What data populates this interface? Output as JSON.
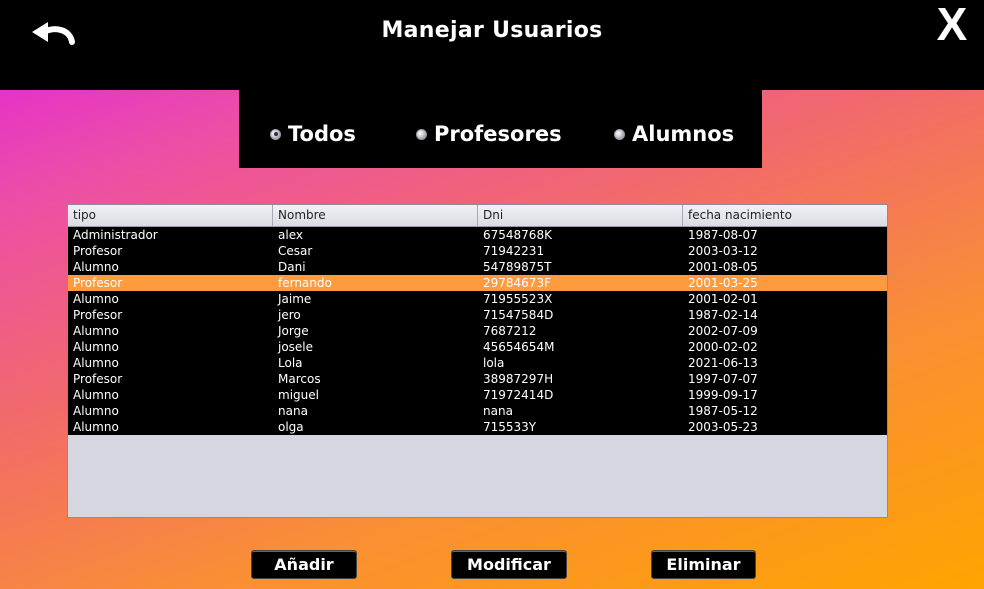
{
  "header": {
    "title": "Manejar Usuarios",
    "back_icon": "undo-arrow-icon",
    "close_label": "X"
  },
  "filter": {
    "options": [
      {
        "label": "Todos",
        "selected": true
      },
      {
        "label": "Profesores",
        "selected": false
      },
      {
        "label": "Alumnos",
        "selected": false
      }
    ]
  },
  "table": {
    "columns": [
      "tipo",
      "Nombre",
      "Dni",
      "fecha nacimiento"
    ],
    "rows": [
      [
        "Administrador",
        "alex",
        "67548768K",
        "1987-08-07"
      ],
      [
        "Profesor",
        "Cesar",
        "71942231",
        "2003-03-12"
      ],
      [
        "Alumno",
        "Dani",
        "54789875T",
        "2001-08-05"
      ],
      [
        "Profesor",
        "fernando",
        "29784673F",
        "2001-03-25"
      ],
      [
        "Alumno",
        "Jaime",
        "71955523X",
        "2001-02-01"
      ],
      [
        "Profesor",
        "jero",
        "71547584D",
        "1987-02-14"
      ],
      [
        "Alumno",
        "Jorge",
        "7687212",
        "2002-07-09"
      ],
      [
        "Alumno",
        "josele",
        "45654654M",
        "2000-02-02"
      ],
      [
        "Alumno",
        "Lola",
        "lola",
        "2021-06-13"
      ],
      [
        "Profesor",
        "Marcos",
        "38987297H",
        "1997-07-07"
      ],
      [
        "Alumno",
        "miguel",
        "71972414D",
        "1999-09-17"
      ],
      [
        "Alumno",
        "nana",
        "nana",
        "1987-05-12"
      ],
      [
        "Alumno",
        "olga",
        "715533Y",
        "2003-05-23"
      ]
    ],
    "selected_row": 3
  },
  "actions": {
    "add_label": "Añadir",
    "modify_label": "Modificar",
    "delete_label": "Eliminar"
  },
  "colors": {
    "selected_row": "#ff9b3f",
    "bar": "#000000"
  }
}
